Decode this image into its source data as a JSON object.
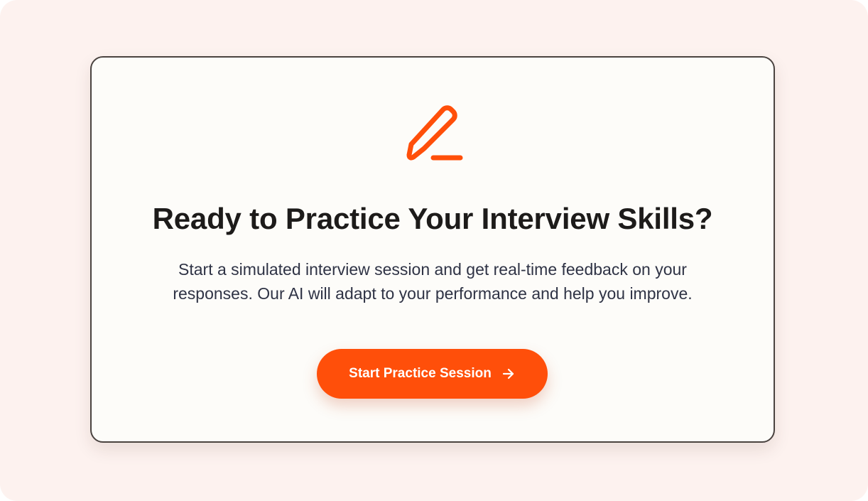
{
  "card": {
    "title": "Ready to Practice Your Interview Skills?",
    "description": "Start a simulated interview session and get real-time feedback on your responses. Our AI will adapt to your performance and help you improve.",
    "icon": "pencil-icon"
  },
  "cta": {
    "label": "Start Practice Session",
    "icon": "arrow-right-icon"
  },
  "colors": {
    "accent": "#ff4f0a",
    "page_background": "#fdf2ef",
    "card_background": "#fdfcf9",
    "title_text": "#1d1b1a",
    "body_text": "#2f3345"
  }
}
